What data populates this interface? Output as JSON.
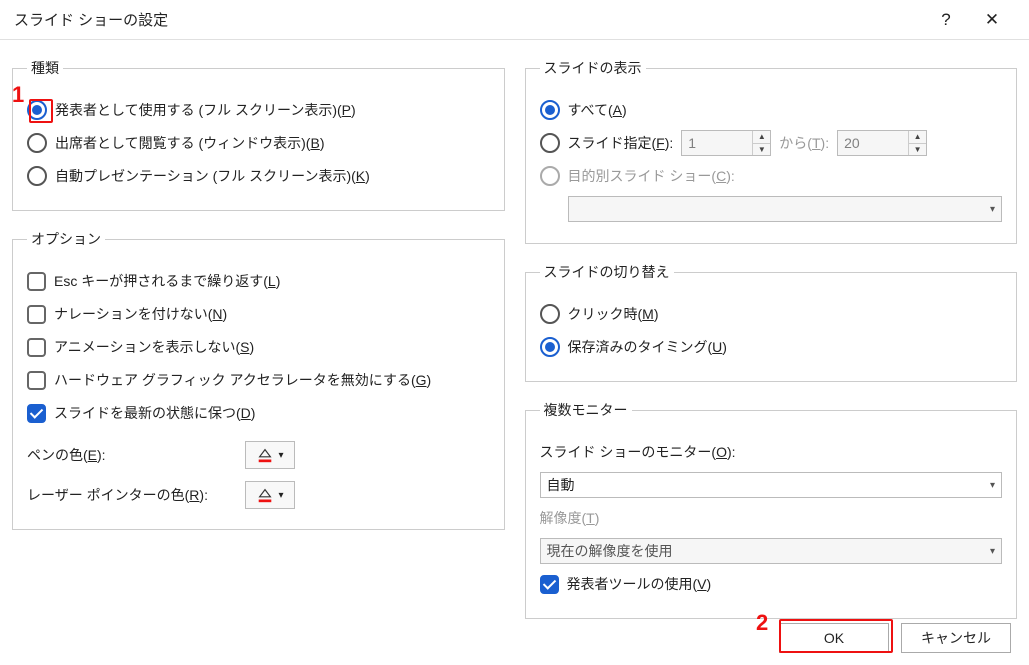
{
  "dialog": {
    "title": "スライド ショーの設定"
  },
  "titlebar": {
    "help": "?",
    "close": "✕"
  },
  "group_type": {
    "legend": "種類",
    "opt1": {
      "text": "発表者として使用する (フル スクリーン表示)(",
      "access": "P",
      "suffix": ")"
    },
    "opt2": {
      "text": "出席者として閲覧する (ウィンドウ表示)(",
      "access": "B",
      "suffix": ")"
    },
    "opt3": {
      "text": "自動プレゼンテーション (フル スクリーン表示)(",
      "access": "K",
      "suffix": ")"
    }
  },
  "group_options": {
    "legend": "オプション",
    "chk1": {
      "text": "Esc キーが押されるまで繰り返す(",
      "access": "L",
      "suffix": ")"
    },
    "chk2": {
      "text": "ナレーションを付けない(",
      "access": "N",
      "suffix": ")"
    },
    "chk3": {
      "text": "アニメーションを表示しない(",
      "access": "S",
      "suffix": ")"
    },
    "chk4": {
      "text": "ハードウェア グラフィック アクセラレータを無効にする(",
      "access": "G",
      "suffix": ")"
    },
    "chk5": {
      "text": "スライドを最新の状態に保つ(",
      "access": "D",
      "suffix": ")"
    },
    "pen": {
      "label": "ペンの色(",
      "access": "E",
      "suffix": "):"
    },
    "laser": {
      "label": "レーザー ポインターの色(",
      "access": "R",
      "suffix": "):"
    }
  },
  "group_show": {
    "legend": "スライドの表示",
    "all": {
      "text": "すべて(",
      "access": "A",
      "suffix": ")"
    },
    "range": {
      "text": "スライド指定(",
      "access": "F",
      "suffix": "):"
    },
    "from_value": "1",
    "to_label": {
      "text": "から(",
      "access": "T",
      "suffix": "):"
    },
    "to_value": "20",
    "custom": {
      "text": "目的別スライド ショー(",
      "access": "C",
      "suffix": "):"
    },
    "custom_value": ""
  },
  "group_advance": {
    "legend": "スライドの切り替え",
    "manual": {
      "text": "クリック時(",
      "access": "M",
      "suffix": ")"
    },
    "timings": {
      "text": "保存済みのタイミング(",
      "access": "U",
      "suffix": ")"
    }
  },
  "group_monitors": {
    "legend": "複数モニター",
    "monitor_label": {
      "text": "スライド ショーのモニター(",
      "access": "O",
      "suffix": "):"
    },
    "monitor_value": "自動",
    "res_label": {
      "text": "解像度(",
      "access": "T",
      "suffix": ")"
    },
    "res_value": "現在の解像度を使用",
    "presenter": {
      "text": "発表者ツールの使用(",
      "access": "V",
      "suffix": ")"
    }
  },
  "buttons": {
    "ok": "OK",
    "cancel": "キャンセル"
  },
  "annotations": {
    "one": "1",
    "two": "2"
  },
  "colors": {
    "pen": "#e11",
    "laser": "#e11",
    "accent": "#1a5fd0"
  }
}
